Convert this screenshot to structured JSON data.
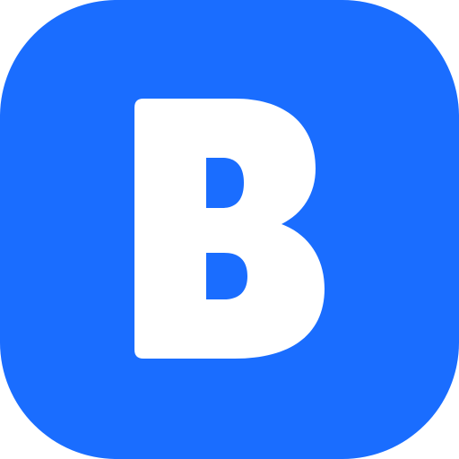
{
  "icon": {
    "name": "B",
    "letter": "B",
    "background_color": "#1A6DFF",
    "foreground_color": "#FFFFFF"
  }
}
